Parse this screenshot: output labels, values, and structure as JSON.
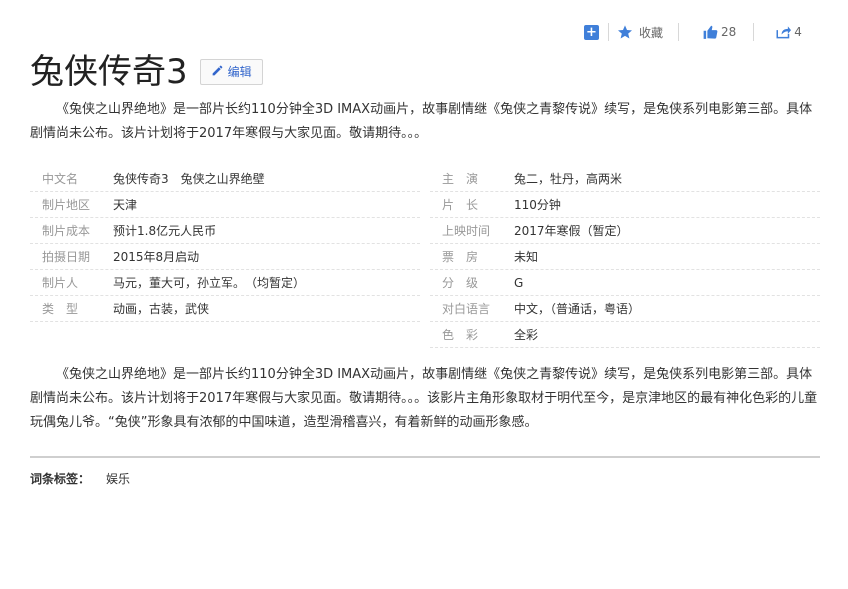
{
  "toolbar": {
    "favorite_label": "收藏",
    "like_count": "28",
    "share_count": "4"
  },
  "header": {
    "title": "兔侠传奇3",
    "edit_label": "编辑"
  },
  "summary": "《兔侠之山界绝地》是一部片长约110分钟全3D IMAX动画片，故事剧情继《兔侠之青黎传说》续写，是兔侠系列电影第三部。具体剧情尚未公布。该片计划将于2017年寒假与大家见面。敬请期待。。。",
  "info_left": [
    {
      "label": "中文名",
      "value": "兔侠传奇3　兔侠之山界绝壁"
    },
    {
      "label": "制片地区",
      "value": "天津"
    },
    {
      "label": "制片成本",
      "value": "预计1.8亿元人民币"
    },
    {
      "label": "拍摄日期",
      "value": "2015年8月启动"
    },
    {
      "label": "制片人",
      "value": "马元，董大可，孙立军。　（均暂定）"
    },
    {
      "label": "类　型",
      "value": "动画，古装，武侠"
    }
  ],
  "info_right": [
    {
      "label": "主　演",
      "value": "兔二，牡丹，高两米"
    },
    {
      "label": "片　长",
      "value": "110分钟"
    },
    {
      "label": "上映时间",
      "value": "2017年寒假（暂定）"
    },
    {
      "label": "票　房",
      "value": "未知"
    },
    {
      "label": "分　级",
      "value": "G"
    },
    {
      "label": "对白语言",
      "value": "中文，（普通话，粤语）"
    },
    {
      "label": "色　彩",
      "value": "全彩"
    }
  ],
  "description": "《兔侠之山界绝地》是一部片长约110分钟全3D IMAX动画片，故事剧情继《兔侠之青黎传说》续写，是兔侠系列电影第三部。具体剧情尚未公布。该片计划将于2017年寒假与大家见面。敬请期待。。。该影片主角形象取材于明代至今，是京津地区的最有神化色彩的儿童玩偶兔儿爷。“兔侠”形象具有浓郁的中国味道，造型滑稽喜兴，有着新鲜的动画形象感。",
  "tags": {
    "label": "词条标签：",
    "items": [
      "娱乐"
    ]
  },
  "colors": {
    "accent": "#3f7fd9",
    "label_gray": "#999999",
    "link_blue": "#3366cc"
  }
}
